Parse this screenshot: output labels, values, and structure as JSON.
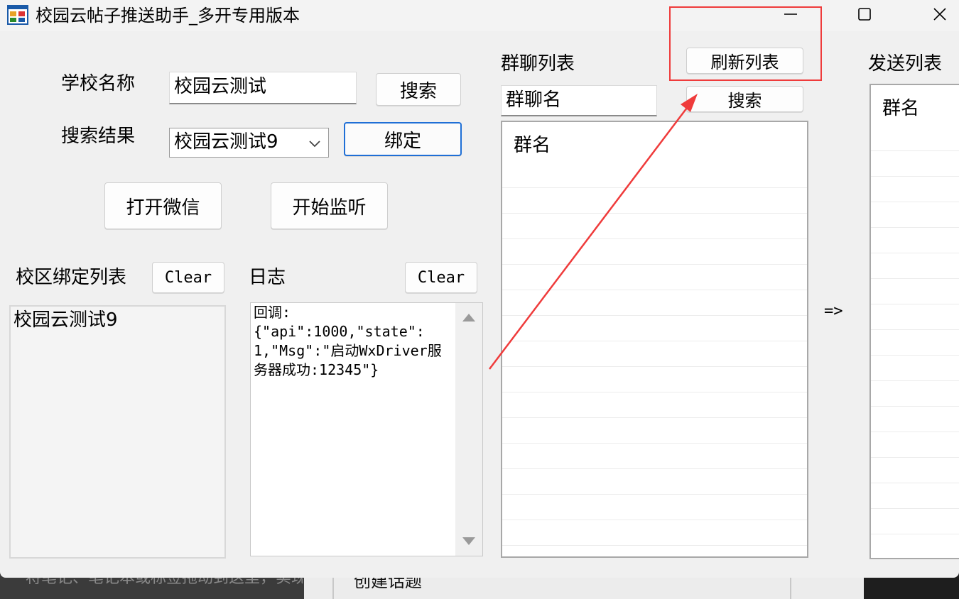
{
  "window": {
    "title": "校园云帖子推送助手_多开专用版本",
    "controls": {
      "minimize": "—",
      "maximize": "☐",
      "close": "✕"
    }
  },
  "form": {
    "school_name_label": "学校名称",
    "school_name_value": "校园云测试",
    "search_button": "搜索",
    "search_result_label": "搜索结果",
    "search_result_value": "校园云测试9",
    "bind_button": "绑定",
    "open_wechat_button": "打开微信",
    "start_listen_button": "开始监听"
  },
  "campus_binding": {
    "label": "校区绑定列表",
    "clear_button": "Clear",
    "items": [
      "校园云测试9"
    ]
  },
  "log": {
    "label": "日志",
    "clear_button": "Clear",
    "text": "回调:\n{\"api\":1000,\"state\":1,\"Msg\":\"启动WxDriver服务器成功:12345\"}"
  },
  "group_list": {
    "label": "群聊列表",
    "refresh_button": "刷新列表",
    "search_value": "群聊名",
    "search_button": "搜索",
    "header": "群名"
  },
  "transfer_arrow": "=>",
  "send_list": {
    "label": "发送列表",
    "header": "群名"
  },
  "background": {
    "left_text": "将笔记、笔记本或标签拖动到这里，实现快速访问",
    "mid_text": "创建话题"
  },
  "colors": {
    "annotation": "#ef3b3b",
    "focus_border": "#1f6fd6"
  }
}
